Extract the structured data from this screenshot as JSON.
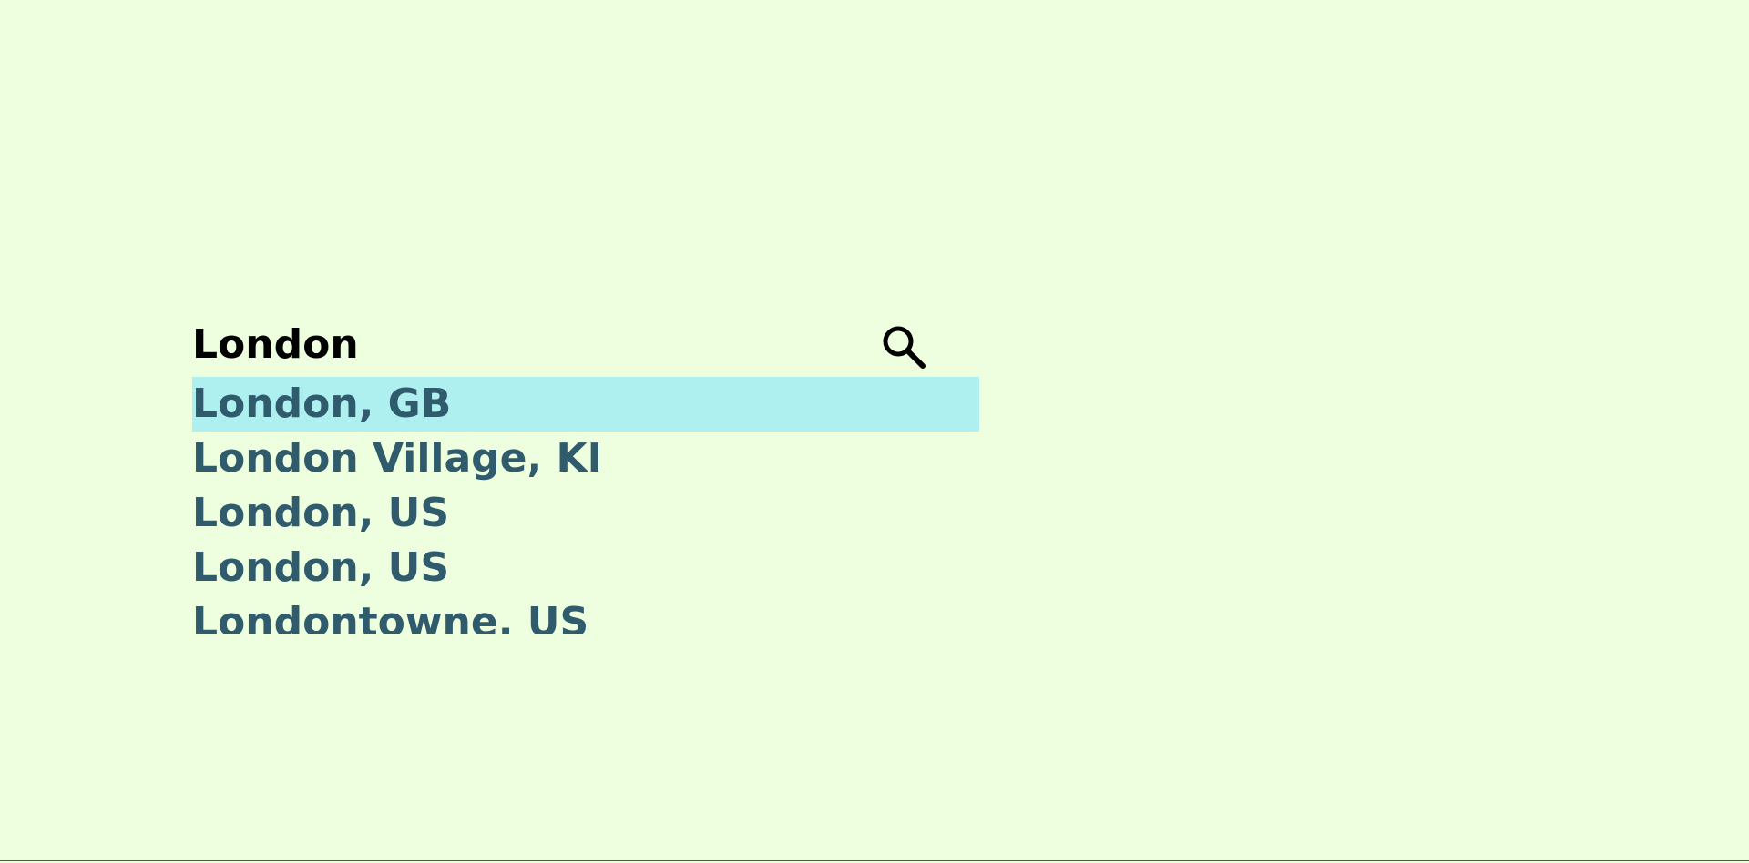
{
  "search": {
    "value": "London",
    "placeholder": "",
    "icon": "search-icon"
  },
  "suggestions": [
    {
      "label": "London, GB",
      "active": true
    },
    {
      "label": "London Village, KI",
      "active": false
    },
    {
      "label": "London, US",
      "active": false
    },
    {
      "label": "London, US",
      "active": false
    },
    {
      "label": "Londontowne, US",
      "active": false
    }
  ],
  "colors": {
    "background": "#eeffdf",
    "highlight": "#aeefef",
    "suggestion_text": "#2f5b6c",
    "input_text": "#000000"
  }
}
